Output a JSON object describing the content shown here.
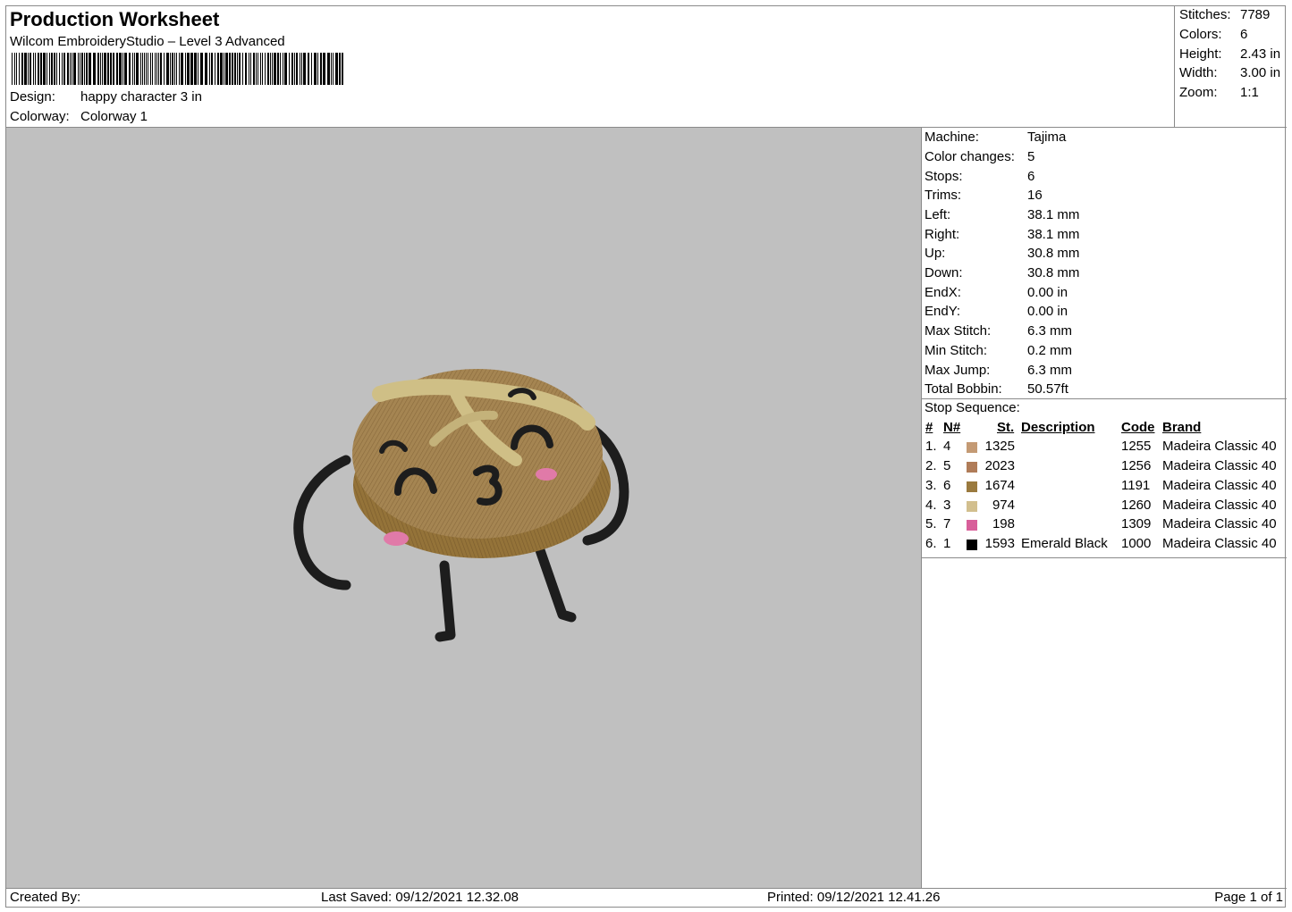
{
  "header": {
    "title": "Production Worksheet",
    "subtitle": "Wilcom EmbroideryStudio – Level 3 Advanced",
    "design_label": "Design:",
    "design_value": "happy character 3 in",
    "colorway_label": "Colorway:",
    "colorway_value": "Colorway 1"
  },
  "stats": [
    {
      "label": "Stitches:",
      "value": "7789"
    },
    {
      "label": "Colors:",
      "value": "6"
    },
    {
      "label": "Height:",
      "value": "2.43 in"
    },
    {
      "label": "Width:",
      "value": "3.00 in"
    },
    {
      "label": "Zoom:",
      "value": "1:1"
    }
  ],
  "machine_info": [
    {
      "label": "Machine:",
      "value": "Tajima"
    },
    {
      "label": "Color changes:",
      "value": "5"
    },
    {
      "label": "Stops:",
      "value": "6"
    },
    {
      "label": "Trims:",
      "value": "16"
    },
    {
      "label": "Left:",
      "value": "38.1 mm"
    },
    {
      "label": "Right:",
      "value": "38.1 mm"
    },
    {
      "label": "Up:",
      "value": "30.8 mm"
    },
    {
      "label": "Down:",
      "value": "30.8 mm"
    },
    {
      "label": "EndX:",
      "value": "0.00 in"
    },
    {
      "label": "EndY:",
      "value": "0.00 in"
    },
    {
      "label": "Max Stitch:",
      "value": "6.3 mm"
    },
    {
      "label": "Min Stitch:",
      "value": "0.2 mm"
    },
    {
      "label": "Max Jump:",
      "value": "6.3 mm"
    },
    {
      "label": "Total Bobbin:",
      "value": "50.57ft"
    }
  ],
  "stop_sequence": {
    "title": "Stop Sequence:",
    "headers": {
      "num": "#",
      "n": "N#",
      "st": "St.",
      "description": "Description",
      "code": "Code",
      "brand": "Brand"
    },
    "rows": [
      {
        "num": "1.",
        "n": "4",
        "st": "1325",
        "description": "",
        "code": "1255",
        "brand": "Madeira Classic 40",
        "color": "#c49a74"
      },
      {
        "num": "2.",
        "n": "5",
        "st": "2023",
        "description": "",
        "code": "1256",
        "brand": "Madeira Classic 40",
        "color": "#b07c58"
      },
      {
        "num": "3.",
        "n": "6",
        "st": "1674",
        "description": "",
        "code": "1191",
        "brand": "Madeira Classic 40",
        "color": "#9a7a3e"
      },
      {
        "num": "4.",
        "n": "3",
        "st": "974",
        "description": "",
        "code": "1260",
        "brand": "Madeira Classic 40",
        "color": "#d2bf8e"
      },
      {
        "num": "5.",
        "n": "7",
        "st": "198",
        "description": "",
        "code": "1309",
        "brand": "Madeira Classic 40",
        "color": "#d85f9a"
      },
      {
        "num": "6.",
        "n": "1",
        "st": "1593",
        "description": "Emerald Black",
        "code": "1000",
        "brand": "Madeira Classic 40",
        "color": "#000000"
      }
    ]
  },
  "footer": {
    "created_by": "Created By:",
    "last_saved": "Last Saved: 09/12/2021 12.32.08",
    "printed": "Printed: 09/12/2021 12.41.26",
    "page": "Page 1 of 1"
  }
}
